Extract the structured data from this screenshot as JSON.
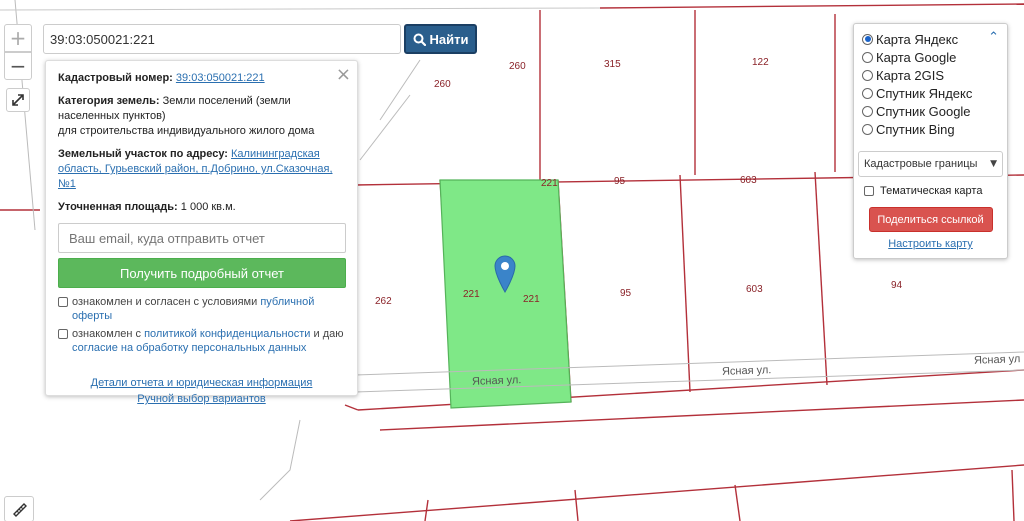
{
  "map": {
    "plot_numbers": [
      "260",
      "260",
      "315",
      "122",
      "221",
      "95",
      "603",
      "262",
      "221",
      "221",
      "95",
      "603",
      "94"
    ],
    "street_labels": [
      "Ясная ул.",
      "Ясная ул.",
      "Ясная ул"
    ],
    "highlight_color": "#7fe887",
    "boundary_color": "#b3303a"
  },
  "controls": {
    "zoom_in": "+",
    "zoom_out": "−",
    "fullscreen_icon": "expand-icon",
    "ruler_icon": "ruler-icon"
  },
  "search": {
    "value": "39:03:050021:221",
    "button_label": "Найти"
  },
  "info": {
    "close": "×",
    "cad_label": "Кадастровый номер:",
    "cad_value": "39:03:050021:221",
    "category_label": "Категория земель:",
    "category_value": "Земли поселений (земли населенных пунктов)",
    "category_use": "для строительства индивидуального жилого дома",
    "address_label": "Земельный участок по адресу:",
    "address_value": "Калининградская область, Гурьевский район, п.Добрино, ул.Сказочная, №1",
    "area_label": "Уточненная площадь:",
    "area_value": "1 000 кв.м.",
    "email_placeholder": "Ваш email, куда отправить отчет",
    "report_button": "Получить подробный отчет",
    "consent1_text": "ознакомлен и согласен с условиями",
    "consent1_link": "публичной оферты",
    "consent2_text": "ознакомлен с",
    "consent2_link": "политикой конфиденциальности",
    "consent2_text2": "и даю",
    "consent2_line2": "согласие на обработку персональных данных",
    "details_link": "Детали отчета и юридическая информация",
    "manual_link": "Ручной выбор вариантов"
  },
  "layers": {
    "options": [
      {
        "label": "Карта Яндекс",
        "checked": true
      },
      {
        "label": "Карта Google",
        "checked": false
      },
      {
        "label": "Карта 2GIS",
        "checked": false
      },
      {
        "label": "Спутник Яндекс",
        "checked": false
      },
      {
        "label": "Спутник Google",
        "checked": false
      },
      {
        "label": "Спутник Bing",
        "checked": false
      }
    ],
    "boundaries_select": "Кадастровые границы",
    "thematic_label": "Тематическая карта",
    "share_button": "Поделиться ссылкой",
    "setup_link": "Настроить карту"
  }
}
